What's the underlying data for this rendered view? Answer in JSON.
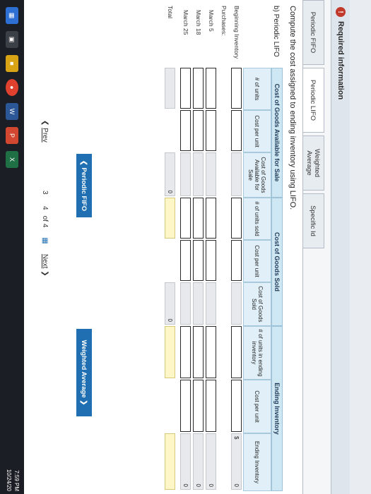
{
  "header": {
    "required_label": "Required information",
    "bang": "!"
  },
  "tabs": [
    {
      "label": "Periodic FIFO",
      "active": false
    },
    {
      "label": "Periodic LIFO",
      "active": true
    },
    {
      "label": "Weighted Average",
      "active": false
    },
    {
      "label": "Specific Id",
      "active": false
    }
  ],
  "main": {
    "prompt": "Compute the cost assigned to ending inventory using LIFO.",
    "section_label": "b) Periodic LIFO",
    "groups": {
      "available": "Cost of Goods Available for Sale",
      "sold": "Cost of Goods Sold",
      "ending": "Ending Inventory"
    },
    "columns": {
      "avail_units": "# of units",
      "avail_cost_per_unit": "Cost per unit",
      "avail_cost": "Cost of Goods Available for Sale",
      "sold_units": "# of units sold",
      "sold_cost_per_unit": "Cost per unit",
      "sold_cost": "Cost of Goods Sold",
      "end_units": "# of units in ending inventory",
      "end_cost_per_unit": "Cost per unit",
      "end_inventory": "Ending Inventory"
    },
    "rows": [
      "Beginning Inventory",
      "Purchases:",
      "March 5",
      "March 18",
      "March 25",
      "Total"
    ],
    "values": {
      "dollar": "$",
      "ending_beg": "0",
      "ending_m5": "0",
      "ending_m18": "0",
      "ending_m25": "0",
      "total_avail": "0",
      "total_sold": "0"
    }
  },
  "nav": {
    "prev_tab": "Periodic FIFO",
    "next_tab": "Weighted Average"
  },
  "pager": {
    "prev": "Prev",
    "current": "3",
    "next_page": "4",
    "of": "of 4",
    "next": "Next"
  },
  "taskbar": {
    "time": "7:59 PM",
    "date": "10/24/20"
  }
}
